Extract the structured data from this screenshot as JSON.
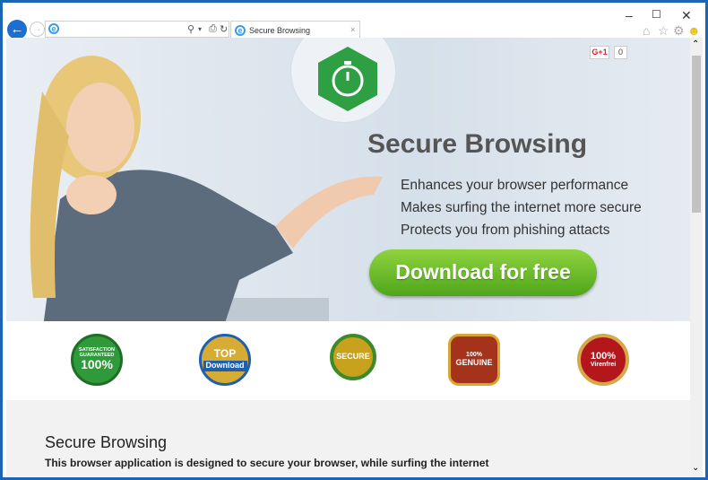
{
  "browser": {
    "tab_title": "Secure Browsing",
    "address": "",
    "window_controls": {
      "minimize": "–",
      "maximize": "☐",
      "close": "✕"
    },
    "toolbar_icons": [
      "home-icon",
      "star-icon",
      "gear-icon",
      "smiley-icon"
    ]
  },
  "gplus": {
    "label": "G+1",
    "count": "0"
  },
  "hero": {
    "title": "Secure Browsing",
    "features": [
      "Enhances your browser performance",
      "Makes surfing the internet more secure",
      "Protects you from phishing attacts"
    ],
    "cta": "Download for free"
  },
  "badges": [
    {
      "text": "100%",
      "sub": "SATISFACTION GUARANTEED",
      "color": "#2e9a3a"
    },
    {
      "text": "TOP",
      "sub": "Download",
      "color": "#1f5fb0"
    },
    {
      "text": "SECURE",
      "sub": "",
      "color": "#c8a21c"
    },
    {
      "text": "GENUINE",
      "sub": "100%",
      "color": "#a5331b"
    },
    {
      "text": "100%",
      "sub": "Virenfrei",
      "color": "#b3171c"
    }
  ],
  "section": {
    "title": "Secure Browsing",
    "description": "This browser application is designed to secure your browser, while surfing the internet"
  },
  "colors": {
    "frame": "#1c64b4",
    "cta_green": "#6cbf2a",
    "logo_green": "#2ea043"
  }
}
